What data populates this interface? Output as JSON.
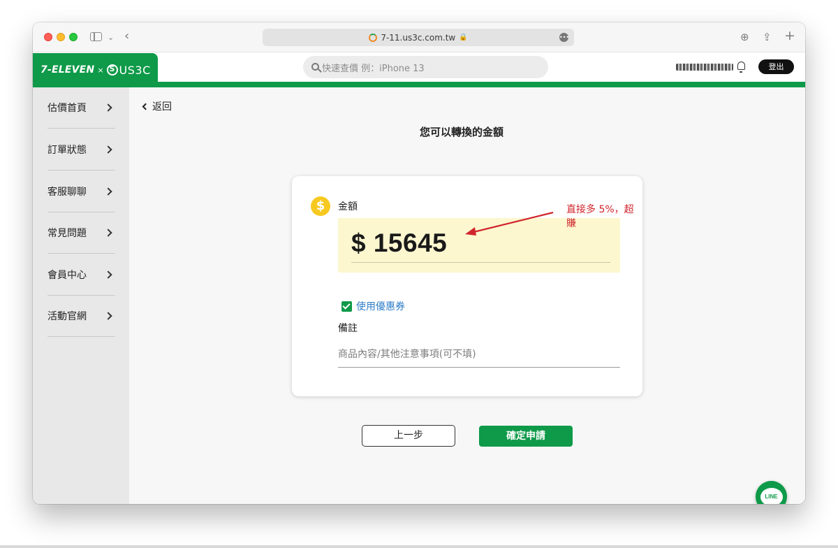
{
  "browser": {
    "url": "7-11.us3c.com.tw"
  },
  "header": {
    "brand_711": "7-ELEVEN",
    "brand_sep": "×",
    "brand_us3c": "US3C",
    "search_placeholder": "快速查價 例：iPhone 13",
    "logout_label": "登出"
  },
  "sidebar": {
    "items": [
      {
        "label": "估價首頁"
      },
      {
        "label": "訂單狀態"
      },
      {
        "label": "客服聊聊"
      },
      {
        "label": "常見問題"
      },
      {
        "label": "會員中心"
      },
      {
        "label": "活動官網"
      }
    ]
  },
  "main": {
    "back_label": "返回",
    "title": "您可以轉換的金額",
    "amount_label": "金額",
    "amount_value": "$ 15645",
    "annotation": "直接多 5%，超賺",
    "coupon_label": "使用優惠券",
    "note_label": "備註",
    "note_placeholder": "商品內容/其他注意事項(可不填)",
    "prev_button": "上一步",
    "submit_button": "確定申請",
    "line_label": "LINE",
    "coin_symbol": "$"
  },
  "colors": {
    "brand_green": "#0e9a49",
    "amount_bg": "#fdf7cf",
    "annotation_red": "#d0262d",
    "link_blue": "#2d7dc8"
  }
}
